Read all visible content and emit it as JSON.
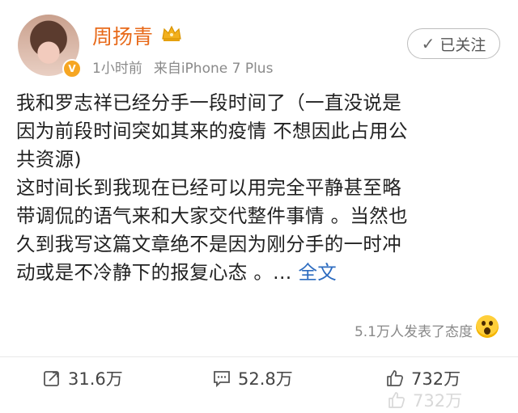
{
  "post": {
    "username": "周扬青",
    "time": "1小时前",
    "source": "来自iPhone 7 Plus",
    "follow_label": "已关注",
    "content_lines": [
      "我和罗志祥已经分手一段时间了（一直没说是",
      "因为前段时间突如其来的疫情 不想因此占用公",
      "共资源)",
      "这时间长到我现在已经可以用完全平静甚至略",
      "带调侃的语气来和大家交代整件事情 。当然也",
      "久到我写这篇文章绝不是因为刚分手的一时冲",
      "动或是不冷静下的报复心态 。..."
    ],
    "full_text_link": "全文",
    "reactions_text": "5.1万人发表了态度"
  },
  "actions": {
    "repost_count": "31.6万",
    "comment_count": "52.8万",
    "like_count": "732万"
  },
  "icons": {
    "verified": "verified-v-badge-icon",
    "crown": "crown-icon",
    "follow": "check-icon",
    "emoji": "wow-emoji-icon",
    "repost": "repost-icon",
    "comment": "comment-icon",
    "like": "thumbs-up-icon"
  },
  "colors": {
    "username": "#e86a1a",
    "link": "#2d6cc0",
    "badge": "#f6a623"
  }
}
